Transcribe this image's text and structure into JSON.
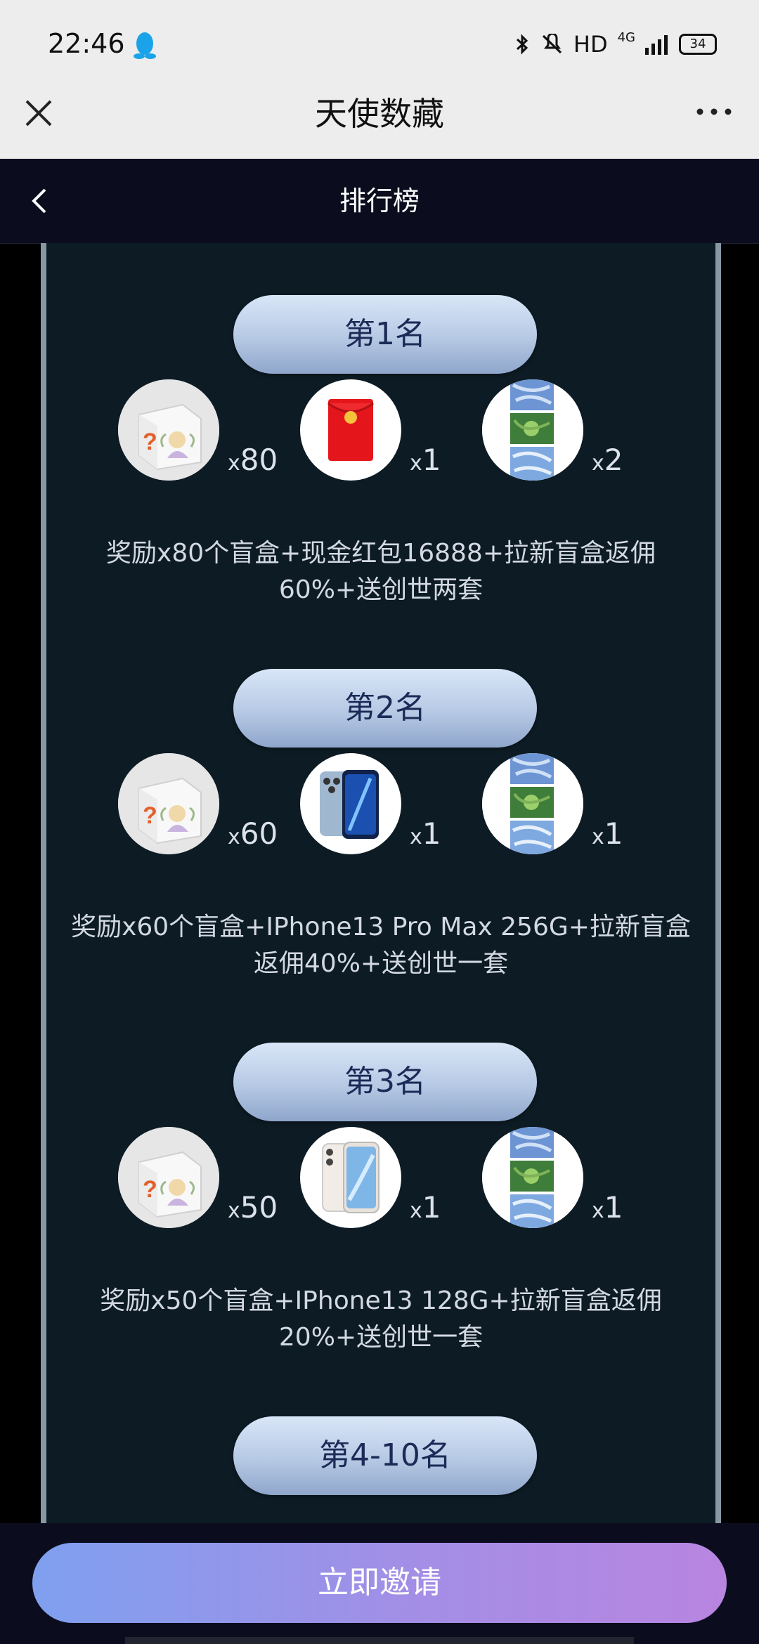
{
  "status_bar": {
    "time": "22:46",
    "hd": "HD",
    "network": "4G",
    "battery": "34"
  },
  "app_header": {
    "title": "天使数藏"
  },
  "nav": {
    "title": "排行榜"
  },
  "ranks": [
    {
      "title": "第1名",
      "rewards": [
        {
          "icon": "blind-box-icon",
          "count": "80"
        },
        {
          "icon": "red-envelope-icon",
          "count": "1"
        },
        {
          "icon": "collectible-set-icon",
          "count": "2"
        }
      ],
      "desc_line1": "奖励x80个盲盒+现金红包16888+拉新盲盒返佣",
      "desc_line2": "60%+送创世两套"
    },
    {
      "title": "第2名",
      "rewards": [
        {
          "icon": "blind-box-icon",
          "count": "60"
        },
        {
          "icon": "iphone-pro-icon",
          "count": "1"
        },
        {
          "icon": "collectible-set-icon",
          "count": "1"
        }
      ],
      "desc_line1": "奖励x60个盲盒+IPhone13 Pro Max 256G+拉新盲盒",
      "desc_line2": "返佣40%+送创世一套"
    },
    {
      "title": "第3名",
      "rewards": [
        {
          "icon": "blind-box-icon",
          "count": "50"
        },
        {
          "icon": "iphone-icon",
          "count": "1"
        },
        {
          "icon": "collectible-set-icon",
          "count": "1"
        }
      ],
      "desc_line1": "奖励x50个盲盒+IPhone13 128G+拉新盲盒返佣",
      "desc_line2": "20%+送创世一套"
    },
    {
      "title": "第4-10名"
    }
  ],
  "count_prefix": "x",
  "invite_button": "立即邀请",
  "colors": {
    "panel": "#0d1b24",
    "pill_text": "#1b2b57",
    "button_start": "#7fa0ef",
    "button_end": "#b885e0"
  }
}
